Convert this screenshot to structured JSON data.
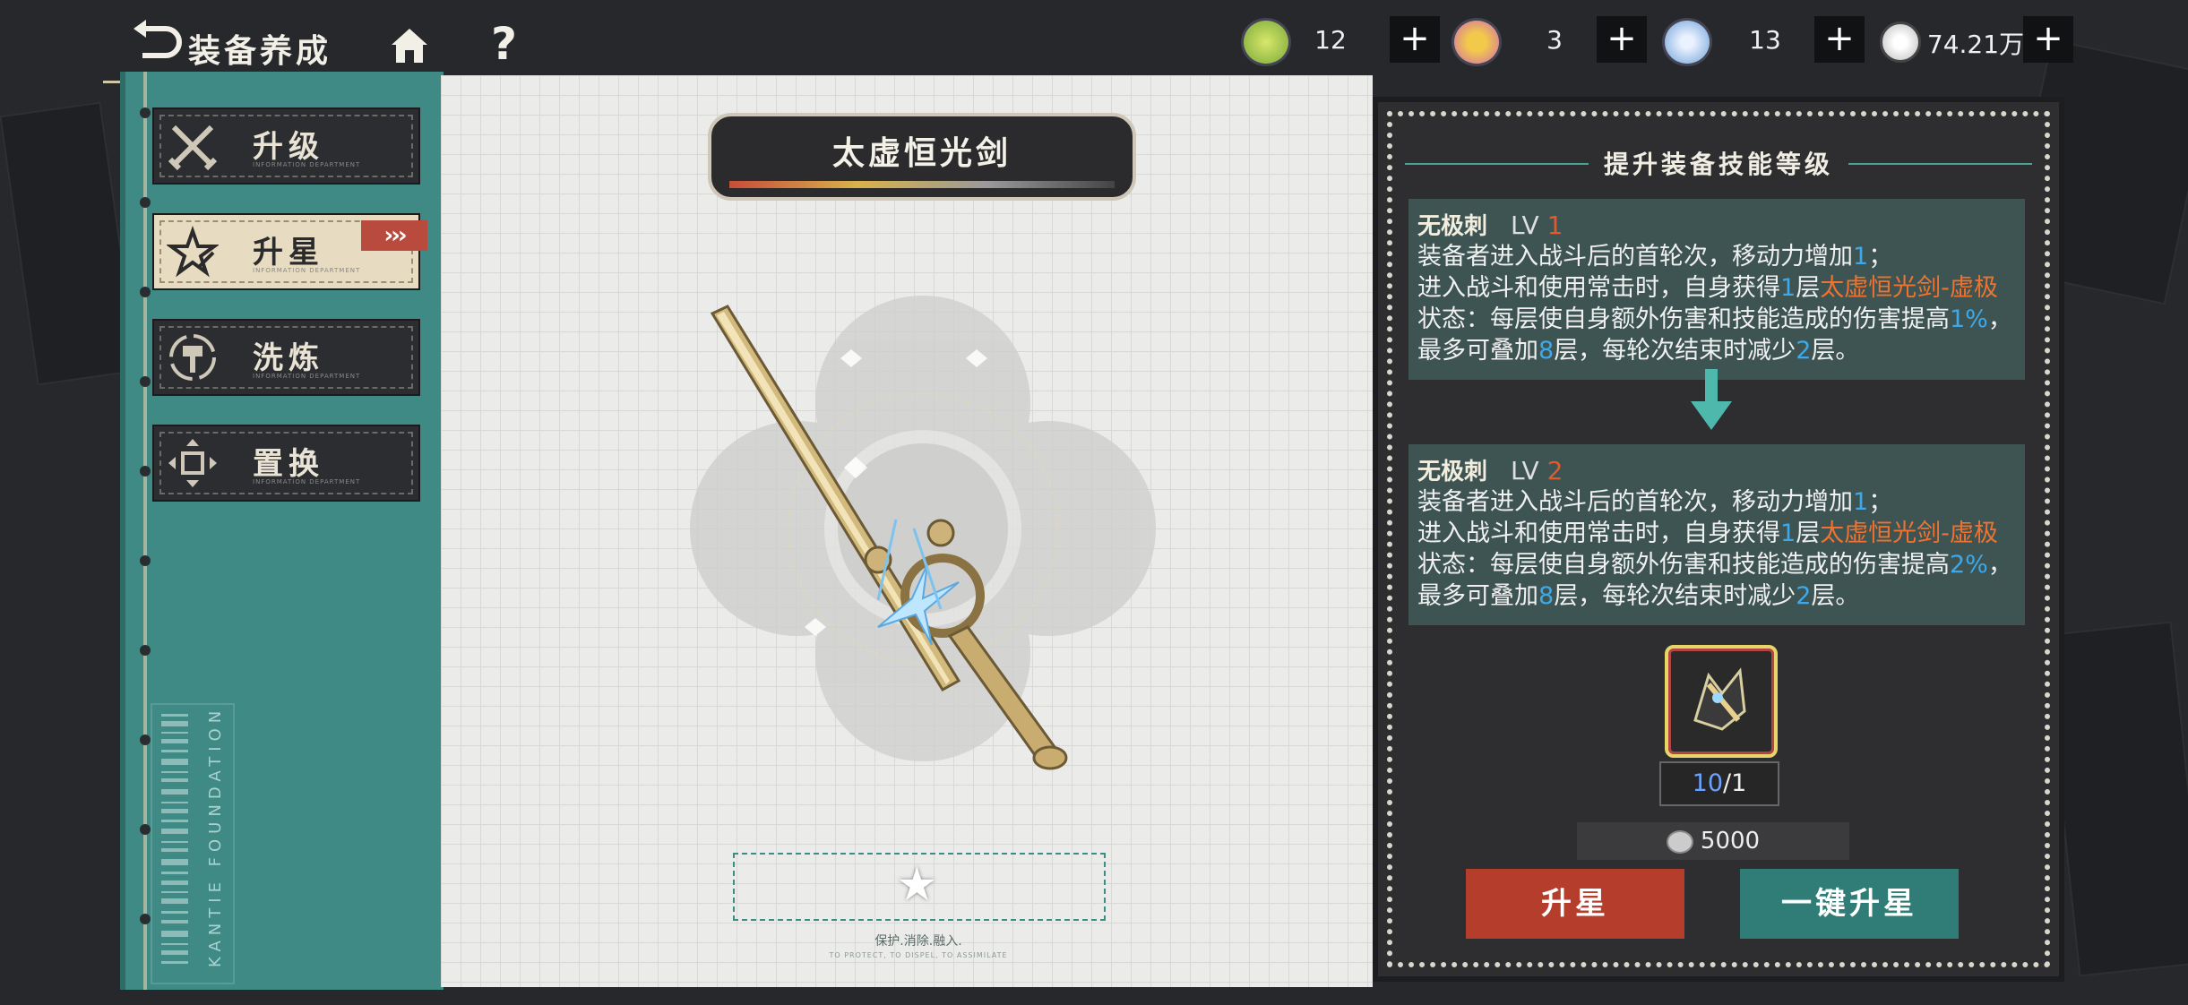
{
  "header": {
    "title": "装备养成",
    "resources": [
      {
        "icon": "green-swap-currency-icon",
        "value": "12"
      },
      {
        "icon": "pink-ring-currency-icon",
        "value": "3"
      },
      {
        "icon": "blue-clock-currency-icon",
        "value": "13"
      },
      {
        "icon": "silver-coin-icon",
        "value": "74.21万"
      }
    ],
    "plus_label": "+",
    "help_label": "?"
  },
  "sidebar": {
    "items": [
      {
        "label": "升级",
        "sub": "INFORMATION DEPARTMENT",
        "icon": "crossed-swords-icon",
        "active": false
      },
      {
        "label": "升星",
        "sub": "INFORMATION DEPARTMENT",
        "icon": "star-upgrade-icon",
        "active": true
      },
      {
        "label": "洗炼",
        "sub": "INFORMATION DEPARTMENT",
        "icon": "hammer-refine-icon",
        "active": false
      },
      {
        "label": "置换",
        "sub": "INFORMATION DEPARTMENT",
        "icon": "swap-arrows-icon",
        "active": false
      }
    ],
    "active_marker": "›››",
    "barcode_text": "KANTIE FOUNDATION"
  },
  "equipment": {
    "name": "太虚恒光剑",
    "slot_caption": "保护.消除.融入.",
    "slot_caption_en": "TO PROTECT, TO DISPEL, TO ASSIMILATE"
  },
  "panel": {
    "title": "提升装备技能等级",
    "current": {
      "name": "无极刺",
      "lv_prefix": "LV",
      "lv": "1",
      "line1": "装备者进入战斗后的首轮次，移动力增加",
      "line1_val": "1",
      "line1_end": "；",
      "line2": "进入战斗和使用常击时，自身获得",
      "stack_val": "1",
      "line2_mid": "层",
      "status_name": "太虚恒光剑-虚极",
      "line3": "状态：每层使自身额外伤害和技能造成的伤害提高",
      "pct": "1%",
      "line3_mid": "，最多可叠加",
      "max_val": "8",
      "line3_end": "层，每轮次结束时减少",
      "dec_val": "2",
      "line4": "层。"
    },
    "next": {
      "name": "无极刺",
      "lv_prefix": "LV",
      "lv": "2",
      "line1": "装备者进入战斗后的首轮次，移动力增加",
      "line1_val": "1",
      "line1_end": "；",
      "line2": "进入战斗和使用常击时，自身获得",
      "stack_val": "1",
      "line2_mid": "层",
      "status_name": "太虚恒光剑-虚极",
      "line3": "状态：每层使自身额外伤害和技能造成的伤害提高",
      "pct": "2%",
      "line3_mid": "，最多可叠加",
      "max_val": "8",
      "line3_end": "层，每轮次结束时减少",
      "dec_val": "2",
      "line4": "层。"
    },
    "material": {
      "icon": "sword-fragment-material-icon",
      "have": "10",
      "need": "/1"
    },
    "cost": {
      "icon": "silver-coin-icon",
      "value": "5000"
    },
    "star_button": "升星",
    "onekey_button": "一键升星"
  },
  "colors": {
    "accent_teal": "#3f8a85",
    "accent_red": "#b53d2c",
    "highlight_blue": "#3ea8e8",
    "highlight_orange": "#f0722e"
  }
}
